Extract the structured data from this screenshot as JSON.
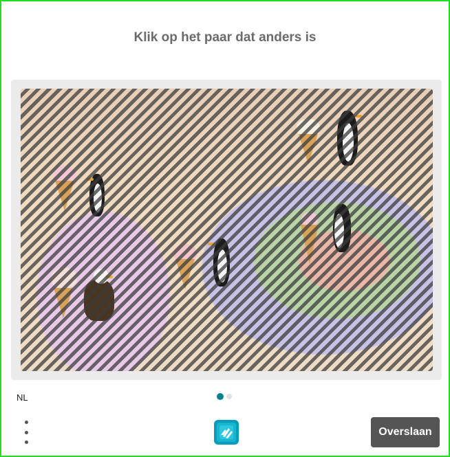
{
  "prompt": {
    "text": "Klik op het paar dat anders is"
  },
  "puzzle": {
    "objects": [
      "ice-cream",
      "penguin",
      "ice-cream",
      "penguin",
      "ice-cream",
      "penguin",
      "ice-cream",
      "eagle",
      "ice-cream",
      "penguin"
    ]
  },
  "footer": {
    "language": "NL",
    "pagination": {
      "current": 1,
      "total": 2
    },
    "menu_icon": "kebab-menu-icon",
    "logo_icon": "hcaptcha-logo-icon",
    "skip_label": "Overslaan"
  },
  "colors": {
    "border": "#22dd22",
    "accent": "#00838f",
    "button_bg": "#555555",
    "prompt_text": "#6b6b6b"
  }
}
